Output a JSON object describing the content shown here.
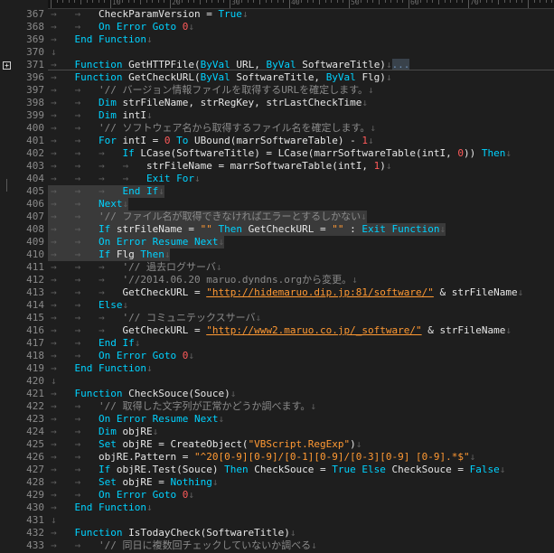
{
  "editor": {
    "colors": {
      "background": "#1e1e1e",
      "keyword": "#00d2ff",
      "string": "#ff9933",
      "number": "#ff5a5a",
      "comment": "#8a8a8a",
      "selection": "#3a3a3a"
    },
    "ruler_numbers": [
      "10",
      "20",
      "30",
      "40",
      "50",
      "60",
      "70"
    ],
    "fold_marker": "...",
    "lines": [
      {
        "n": "367",
        "t": [
          [
            "tab",
            "→   →   "
          ],
          [
            "txt",
            "CheckParamVersion = "
          ],
          [
            "kw",
            "True"
          ],
          [
            "eol",
            "↓"
          ]
        ]
      },
      {
        "n": "368",
        "t": [
          [
            "tab",
            "→   →   "
          ],
          [
            "kw",
            "On Error Goto "
          ],
          [
            "num",
            "0"
          ],
          [
            "eol",
            "↓"
          ]
        ]
      },
      {
        "n": "369",
        "t": [
          [
            "tab",
            "→   "
          ],
          [
            "kw",
            "End Function"
          ],
          [
            "eol",
            "↓"
          ]
        ]
      },
      {
        "n": "370",
        "t": [
          [
            "eol",
            "↓"
          ]
        ]
      },
      {
        "n": "371",
        "fold": true,
        "t": [
          [
            "tab",
            "→   "
          ],
          [
            "kw",
            "Function "
          ],
          [
            "txt",
            "GetHTTPFile("
          ],
          [
            "kw",
            "ByVal "
          ],
          [
            "txt",
            "URL, "
          ],
          [
            "kw",
            "ByVal "
          ],
          [
            "txt",
            "SoftwareTitle)"
          ],
          [
            "eol",
            "↓"
          ],
          [
            "fold",
            "..."
          ]
        ]
      },
      {
        "n": "396",
        "t": [
          [
            "tab",
            "→   "
          ],
          [
            "kw",
            "Function "
          ],
          [
            "txt",
            "GetCheckURL("
          ],
          [
            "kw",
            "ByVal "
          ],
          [
            "txt",
            "SoftwareTitle, "
          ],
          [
            "kw",
            "ByVal "
          ],
          [
            "txt",
            "Flg)"
          ],
          [
            "eol",
            "↓"
          ]
        ]
      },
      {
        "n": "397",
        "t": [
          [
            "tab",
            "→   →   "
          ],
          [
            "cm",
            "'// バージョン情報ファイルを取得するURLを確定します。"
          ],
          [
            "eol",
            "↓"
          ]
        ]
      },
      {
        "n": "398",
        "t": [
          [
            "tab",
            "→   →   "
          ],
          [
            "kw",
            "Dim "
          ],
          [
            "txt",
            "strFileName, strRegKey, strLastCheckTime"
          ],
          [
            "eol",
            "↓"
          ]
        ]
      },
      {
        "n": "399",
        "t": [
          [
            "tab",
            "→   →   "
          ],
          [
            "kw",
            "Dim "
          ],
          [
            "txt",
            "intI"
          ],
          [
            "eol",
            "↓"
          ]
        ]
      },
      {
        "n": "400",
        "t": [
          [
            "tab",
            "→   →   "
          ],
          [
            "cm",
            "'// ソフトウェア名から取得するファイル名を確定します。"
          ],
          [
            "eol",
            "↓"
          ]
        ]
      },
      {
        "n": "401",
        "t": [
          [
            "tab",
            "→   →   "
          ],
          [
            "kw",
            "For "
          ],
          [
            "txt",
            "intI = "
          ],
          [
            "num",
            "0"
          ],
          [
            "kw",
            " To "
          ],
          [
            "txt",
            "UBound(marrSoftwareTable) - "
          ],
          [
            "num",
            "1"
          ],
          [
            "eol",
            "↓"
          ]
        ]
      },
      {
        "n": "402",
        "t": [
          [
            "tab",
            "→   →   →   "
          ],
          [
            "kw",
            "If "
          ],
          [
            "txt",
            "LCase(SoftwareTitle) = LCase(marrSoftwareTable(intI, "
          ],
          [
            "num",
            "0"
          ],
          [
            "txt",
            ")) "
          ],
          [
            "kw",
            "Then"
          ],
          [
            "eol",
            "↓"
          ]
        ]
      },
      {
        "n": "403",
        "t": [
          [
            "tab",
            "→   →   →   →   "
          ],
          [
            "txt",
            "strFileName = marrSoftwareTable(intI, "
          ],
          [
            "num",
            "1"
          ],
          [
            "txt",
            ")"
          ],
          [
            "eol",
            "↓"
          ]
        ]
      },
      {
        "n": "404",
        "t": [
          [
            "tab",
            "→   →   →   →   "
          ],
          [
            "kw",
            "Exit For"
          ],
          [
            "eol",
            "↓"
          ]
        ]
      },
      {
        "n": "405",
        "sel": true,
        "t": [
          [
            "tab",
            "→   →   →   "
          ],
          [
            "kw",
            "End If"
          ],
          [
            "eol",
            "↓"
          ]
        ]
      },
      {
        "n": "406",
        "sel": true,
        "t": [
          [
            "tab",
            "→   →   "
          ],
          [
            "kw",
            "Next"
          ],
          [
            "eol",
            "↓"
          ]
        ]
      },
      {
        "n": "407",
        "sel": true,
        "t": [
          [
            "tab",
            "→   →   "
          ],
          [
            "cm",
            "'// ファイル名が取得できなければエラーとするしかない"
          ],
          [
            "eol",
            "↓"
          ]
        ]
      },
      {
        "n": "408",
        "sel": true,
        "t": [
          [
            "tab",
            "→   →   "
          ],
          [
            "kw",
            "If "
          ],
          [
            "txt",
            "strFileName = "
          ],
          [
            "str",
            "\"\""
          ],
          [
            "kw",
            " Then "
          ],
          [
            "txt",
            "GetCheckURL = "
          ],
          [
            "str",
            "\"\""
          ],
          [
            "txt",
            " : "
          ],
          [
            "kw",
            "Exit Function"
          ],
          [
            "eol",
            "↓"
          ]
        ]
      },
      {
        "n": "409",
        "sel": true,
        "t": [
          [
            "tab",
            "→   →   "
          ],
          [
            "kw",
            "On Error Resume Next"
          ],
          [
            "eol",
            "↓"
          ]
        ]
      },
      {
        "n": "410",
        "sel": true,
        "t": [
          [
            "tab",
            "→   →   "
          ],
          [
            "kw",
            "If "
          ],
          [
            "txt",
            "Flg "
          ],
          [
            "kw",
            "Then"
          ],
          [
            "eol",
            "↓"
          ]
        ]
      },
      {
        "n": "411",
        "t": [
          [
            "tab",
            "→   →   →   "
          ],
          [
            "cm",
            "'// 過去ログサーバ"
          ],
          [
            "eol",
            "↓"
          ]
        ]
      },
      {
        "n": "412",
        "t": [
          [
            "tab",
            "→   →   →   "
          ],
          [
            "cm",
            "'//2014.06.20 maruo.dyndns.orgから変更。"
          ],
          [
            "eol",
            "↓"
          ]
        ]
      },
      {
        "n": "413",
        "t": [
          [
            "tab",
            "→   →   →   "
          ],
          [
            "txt",
            "GetCheckURL = "
          ],
          [
            "url",
            "\"http://hidemaruo.dip.jp:81/software/\""
          ],
          [
            "txt",
            " & strFileName"
          ],
          [
            "eol",
            "↓"
          ]
        ]
      },
      {
        "n": "414",
        "t": [
          [
            "tab",
            "→   →   "
          ],
          [
            "kw",
            "Else"
          ],
          [
            "eol",
            "↓"
          ]
        ]
      },
      {
        "n": "415",
        "t": [
          [
            "tab",
            "→   →   →   "
          ],
          [
            "cm",
            "'// コミュニテックスサーバ"
          ],
          [
            "eol",
            "↓"
          ]
        ]
      },
      {
        "n": "416",
        "t": [
          [
            "tab",
            "→   →   →   "
          ],
          [
            "txt",
            "GetCheckURL = "
          ],
          [
            "url",
            "\"http://www2.maruo.co.jp/_software/\""
          ],
          [
            "txt",
            " & strFileName"
          ],
          [
            "eol",
            "↓"
          ]
        ]
      },
      {
        "n": "417",
        "t": [
          [
            "tab",
            "→   →   "
          ],
          [
            "kw",
            "End If"
          ],
          [
            "eol",
            "↓"
          ]
        ]
      },
      {
        "n": "418",
        "t": [
          [
            "tab",
            "→   →   "
          ],
          [
            "kw",
            "On Error Goto "
          ],
          [
            "num",
            "0"
          ],
          [
            "eol",
            "↓"
          ]
        ]
      },
      {
        "n": "419",
        "t": [
          [
            "tab",
            "→   "
          ],
          [
            "kw",
            "End Function"
          ],
          [
            "eol",
            "↓"
          ]
        ]
      },
      {
        "n": "420",
        "t": [
          [
            "eol",
            "↓"
          ]
        ]
      },
      {
        "n": "421",
        "t": [
          [
            "tab",
            "→   "
          ],
          [
            "kw",
            "Function "
          ],
          [
            "txt",
            "CheckSouce(Souce)"
          ],
          [
            "eol",
            "↓"
          ]
        ]
      },
      {
        "n": "422",
        "t": [
          [
            "tab",
            "→   →   "
          ],
          [
            "cm",
            "'// 取得した文字列が正常かどうか調べます。"
          ],
          [
            "eol",
            "↓"
          ]
        ]
      },
      {
        "n": "423",
        "t": [
          [
            "tab",
            "→   →   "
          ],
          [
            "kw",
            "On Error Resume Next"
          ],
          [
            "eol",
            "↓"
          ]
        ]
      },
      {
        "n": "424",
        "t": [
          [
            "tab",
            "→   →   "
          ],
          [
            "kw",
            "Dim "
          ],
          [
            "txt",
            "objRE"
          ],
          [
            "eol",
            "↓"
          ]
        ]
      },
      {
        "n": "425",
        "t": [
          [
            "tab",
            "→   →   "
          ],
          [
            "kw",
            "Set "
          ],
          [
            "txt",
            "objRE = CreateObject("
          ],
          [
            "str",
            "\"VBScript.RegExp\""
          ],
          [
            "txt",
            ")"
          ],
          [
            "eol",
            "↓"
          ]
        ]
      },
      {
        "n": "426",
        "t": [
          [
            "tab",
            "→   →   "
          ],
          [
            "txt",
            "objRE.Pattern = "
          ],
          [
            "str",
            "\"^20[0-9][0-9]/[0-1][0-9]/[0-3][0-9] [0-9].*$\""
          ],
          [
            "eol",
            "↓"
          ]
        ]
      },
      {
        "n": "427",
        "t": [
          [
            "tab",
            "→   →   "
          ],
          [
            "kw",
            "If "
          ],
          [
            "txt",
            "objRE.Test(Souce) "
          ],
          [
            "kw",
            "Then "
          ],
          [
            "txt",
            "CheckSouce = "
          ],
          [
            "kw",
            "True Else "
          ],
          [
            "txt",
            "CheckSouce = "
          ],
          [
            "kw",
            "False"
          ],
          [
            "eol",
            "↓"
          ]
        ]
      },
      {
        "n": "428",
        "t": [
          [
            "tab",
            "→   →   "
          ],
          [
            "kw",
            "Set "
          ],
          [
            "txt",
            "objRE = "
          ],
          [
            "kw",
            "Nothing"
          ],
          [
            "eol",
            "↓"
          ]
        ]
      },
      {
        "n": "429",
        "t": [
          [
            "tab",
            "→   →   "
          ],
          [
            "kw",
            "On Error Goto "
          ],
          [
            "num",
            "0"
          ],
          [
            "eol",
            "↓"
          ]
        ]
      },
      {
        "n": "430",
        "t": [
          [
            "tab",
            "→   "
          ],
          [
            "kw",
            "End Function"
          ],
          [
            "eol",
            "↓"
          ]
        ]
      },
      {
        "n": "431",
        "t": [
          [
            "eol",
            "↓"
          ]
        ]
      },
      {
        "n": "432",
        "t": [
          [
            "tab",
            "→   "
          ],
          [
            "kw",
            "Function "
          ],
          [
            "txt",
            "IsTodayCheck(SoftwareTitle)"
          ],
          [
            "eol",
            "↓"
          ]
        ]
      },
      {
        "n": "433",
        "t": [
          [
            "tab",
            "→   →   "
          ],
          [
            "cm",
            "'// 同日に複数回チェックしていないか調べる"
          ],
          [
            "eol",
            "↓"
          ]
        ]
      }
    ]
  }
}
